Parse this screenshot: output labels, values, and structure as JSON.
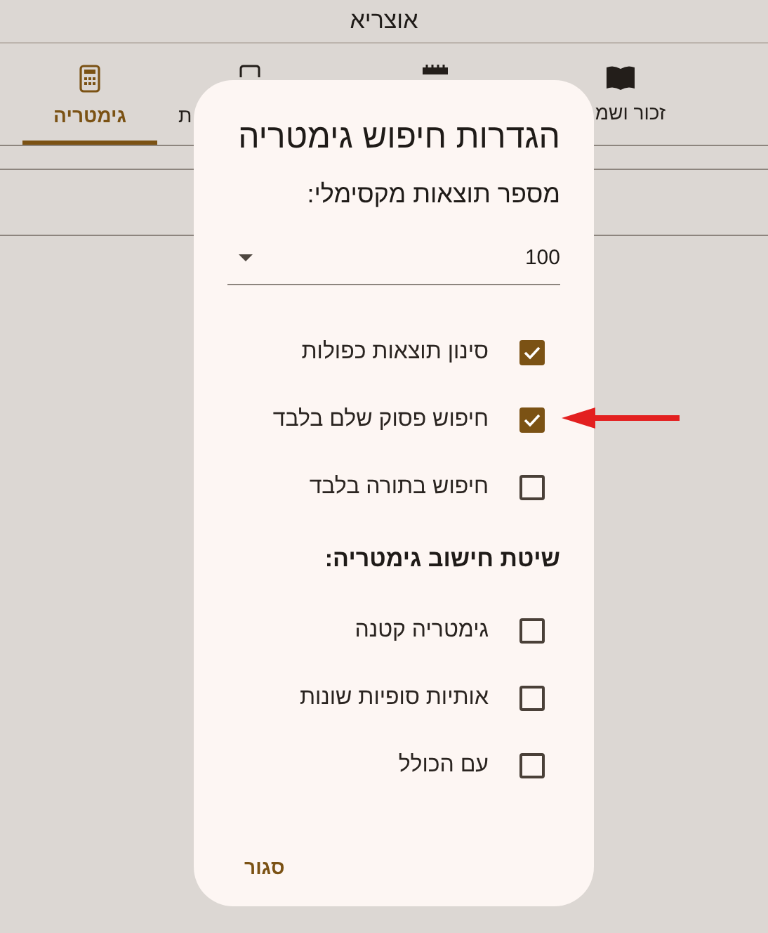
{
  "window": {
    "title": "אוצריא"
  },
  "tabs": [
    {
      "label": "זכור ושמ",
      "selected": false
    },
    {
      "selected": false
    },
    {
      "label": "ת",
      "selected": false
    },
    {
      "label": "גימטריה",
      "selected": true
    }
  ],
  "dialog": {
    "title": "הגדרות חיפוש גימטריה",
    "max_results_label": "מספר תוצאות מקסימלי:",
    "max_results": {
      "value": "100"
    },
    "options": [
      {
        "label": "סינון תוצאות כפולות",
        "checked": true
      },
      {
        "label": "חיפוש פסוק שלם בלבד",
        "checked": true
      },
      {
        "label": "חיפוש בתורה בלבד",
        "checked": false
      }
    ],
    "method_heading": "שיטת חישוב גימטריה:",
    "method_options": [
      {
        "label": "גימטריה קטנה",
        "checked": false
      },
      {
        "label": "אותיות סופיות שונות",
        "checked": false
      },
      {
        "label": "עם הכולל",
        "checked": false
      }
    ],
    "close_button": "סגור"
  },
  "annotation": {
    "kind": "arrow"
  }
}
